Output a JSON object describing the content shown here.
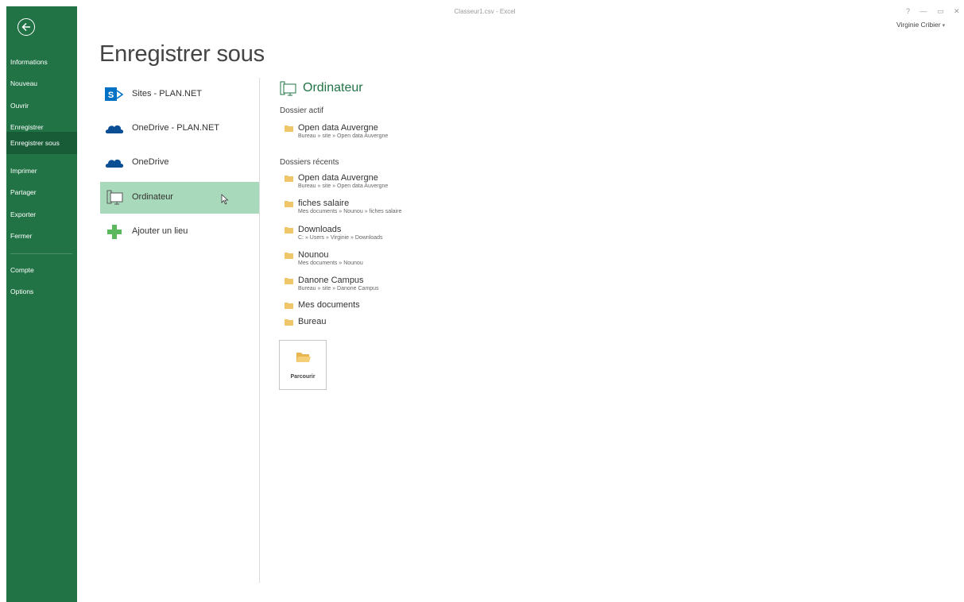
{
  "window": {
    "title": "Classeur1.csv - Excel",
    "controls": "? — ▭ ✕",
    "user": "Virginie Cribier"
  },
  "sidebar": {
    "items": [
      {
        "label": "Informations"
      },
      {
        "label": "Nouveau"
      },
      {
        "label": "Ouvrir"
      },
      {
        "label": "Enregistrer"
      },
      {
        "label": "Enregistrer sous"
      },
      {
        "label": "Imprimer"
      },
      {
        "label": "Partager"
      },
      {
        "label": "Exporter"
      },
      {
        "label": "Fermer"
      },
      {
        "label": "Compte"
      },
      {
        "label": "Options"
      }
    ],
    "active": "Enregistrer sous"
  },
  "page": {
    "title": "Enregistrer sous"
  },
  "places": [
    {
      "label": "Sites - PLAN.NET",
      "icon": "sharepoint-icon"
    },
    {
      "label": "OneDrive - PLAN.NET",
      "icon": "onedrive-icon"
    },
    {
      "label": "OneDrive",
      "icon": "onedrive-icon"
    },
    {
      "label": "Ordinateur",
      "icon": "computer-icon",
      "selected": true
    },
    {
      "label": "Ajouter un lieu",
      "icon": "add-place-icon"
    }
  ],
  "panel": {
    "title": "Ordinateur",
    "current_label": "Dossier actif",
    "current": [
      {
        "name": "Open data Auvergne",
        "path": "Bureau » site » Open data Auvergne"
      }
    ],
    "recent_label": "Dossiers récents",
    "recent": [
      {
        "name": "Open data Auvergne",
        "path": "Bureau » site » Open data Auvergne"
      },
      {
        "name": "fiches salaire",
        "path": "Mes documents » Nounou » fiches salaire"
      },
      {
        "name": "Downloads",
        "path": "C: » Users » Virginie » Downloads"
      },
      {
        "name": "Nounou",
        "path": "Mes documents » Nounou"
      },
      {
        "name": "Danone Campus",
        "path": "Bureau » site » Danone Campus"
      },
      {
        "name": "Mes documents",
        "path": ""
      },
      {
        "name": "Bureau",
        "path": ""
      }
    ],
    "browse_label": "Parcourir"
  },
  "colors": {
    "accent": "#217346",
    "sidebar_active": "#185c37",
    "selected_place": "#a9d9bb",
    "folder": "#f0c66b"
  }
}
